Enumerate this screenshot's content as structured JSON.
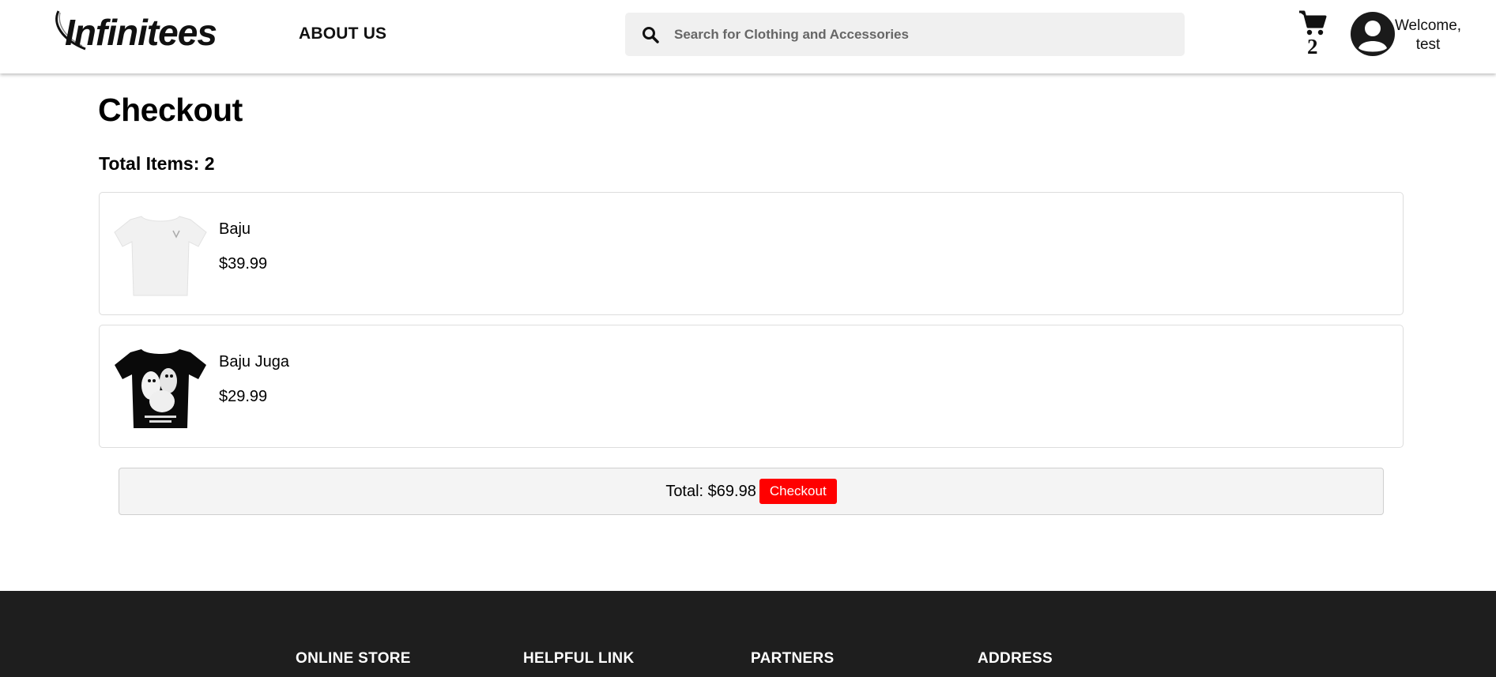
{
  "header": {
    "logo_text": "Infinitees",
    "nav": {
      "about_label": "ABOUT US"
    },
    "search": {
      "placeholder": "Search for Clothing and Accessories",
      "value": ""
    },
    "cart": {
      "count": "2"
    },
    "user": {
      "welcome_line1": "Welcome,",
      "welcome_line2": "test"
    }
  },
  "main": {
    "title": "Checkout",
    "total_items_label": "Total Items: 2",
    "items": [
      {
        "name": "Baju",
        "price": "$39.99",
        "image": "white-tshirt"
      },
      {
        "name": "Baju Juga",
        "price": "$29.99",
        "image": "black-ghost-tshirt"
      }
    ],
    "total_label": "Total: $69.98",
    "checkout_label": "Checkout"
  },
  "footer": {
    "columns": [
      "ONLINE STORE",
      "HELPFUL LINK",
      "PARTNERS",
      "ADDRESS"
    ]
  },
  "colors": {
    "accent": "#ff0000",
    "footer_bg": "#1e1e1e",
    "search_bg": "#f0f0f0"
  }
}
